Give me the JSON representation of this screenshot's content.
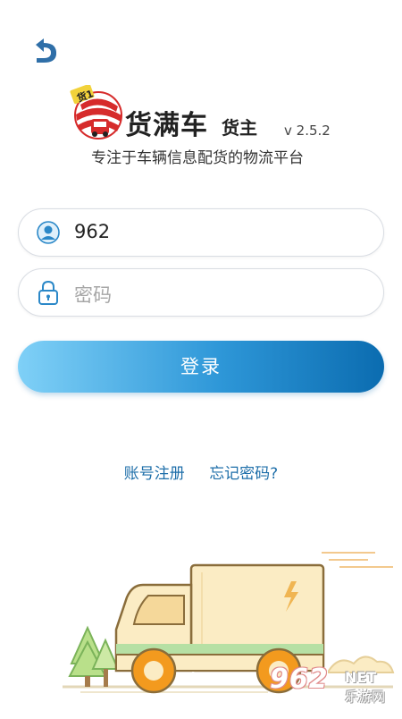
{
  "header": {
    "back_icon": "back-arrow-icon"
  },
  "brand": {
    "name": "货满车",
    "role": "货主",
    "version": "v 2.5.2",
    "slogan": "专注于车辆信息配货的物流平台",
    "logo_text": "货1"
  },
  "form": {
    "username": {
      "value": "962",
      "icon": "user-icon"
    },
    "password": {
      "placeholder": "密码",
      "icon": "lock-icon"
    }
  },
  "actions": {
    "login_label": "登录",
    "register_label": "账号注册",
    "forgot_label": "忘记密码?"
  },
  "watermark": {
    "number": "962",
    "net": "NET",
    "site": "乐游网"
  },
  "colors": {
    "accent": "#2e97d8",
    "link": "#1d6ea9",
    "logo_red": "#d62b2b",
    "truck_body": "#fbecc4"
  }
}
